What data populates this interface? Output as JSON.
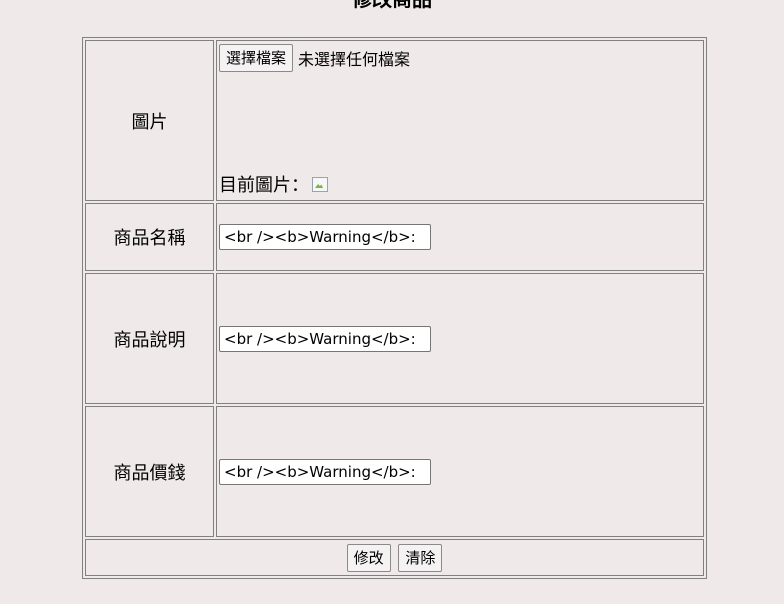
{
  "page": {
    "title": "修改商品"
  },
  "form": {
    "image": {
      "label": "圖片",
      "file_button": "選擇檔案",
      "file_status": "未選擇任何檔案",
      "current_label": "目前圖片："
    },
    "name": {
      "label": "商品名稱",
      "value": "<br /><b>Warning</b>:  Un"
    },
    "description": {
      "label": "商品說明",
      "value": "<br /><b>Warning</b>:  Un"
    },
    "price": {
      "label": "商品價錢",
      "value": "<br /><b>Warning</b>:  Un"
    },
    "actions": {
      "submit": "修改",
      "reset": "清除"
    }
  }
}
